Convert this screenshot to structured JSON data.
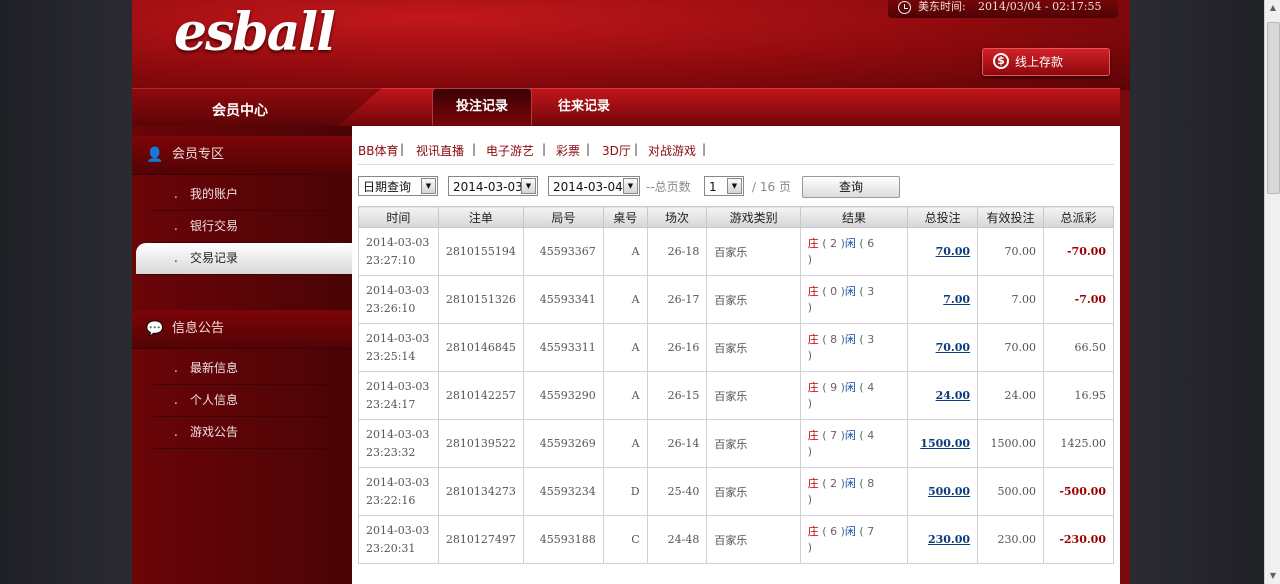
{
  "header": {
    "logo_text": "esball",
    "clock_label": "美东时间:",
    "clock_time": "2014/03/04 - 02:17:55",
    "deposit_label": "线上存款",
    "deposit_icon": "dollar-icon"
  },
  "nav": {
    "member_center": "会员中心",
    "tabs": [
      {
        "label": "投注记录",
        "active": true
      },
      {
        "label": "往来记录",
        "active": false
      }
    ]
  },
  "sidebar": {
    "section1": {
      "title": "会员专区",
      "icon": "user-icon",
      "items": [
        {
          "label": "我的账户",
          "active": false
        },
        {
          "label": "银行交易",
          "active": false
        },
        {
          "label": "交易记录",
          "active": true
        }
      ]
    },
    "section2": {
      "title": "信息公告",
      "icon": "chat-bubble-icon",
      "items": [
        {
          "label": "最新信息"
        },
        {
          "label": "个人信息"
        },
        {
          "label": "游戏公告"
        }
      ]
    },
    "bullet": "."
  },
  "categories": {
    "items": [
      "BB体育",
      "视讯直播",
      "电子游艺",
      "彩票",
      "3D厅",
      "对战游戏"
    ],
    "separator": "|"
  },
  "filter": {
    "mode": "日期查询",
    "start_date": "2014-03-03",
    "end_date": "2014-03-04",
    "total_pages_label": "--总页数",
    "current_page": "1",
    "pages_suffix": "/ 16 页",
    "query_button": "查询"
  },
  "table": {
    "columns": [
      "时间",
      "注单",
      "局号",
      "桌号",
      "场次",
      "游戏类别",
      "结果",
      "总投注",
      "有效投注",
      "总派彩"
    ],
    "banker_label": "庄",
    "player_label": "闲",
    "rows": [
      {
        "date": "2014-03-03",
        "time": "23:27:10",
        "ticket": "2810155194",
        "round": "45593367",
        "table": "A",
        "shoe": "26-18",
        "game": "百家乐",
        "banker": "2",
        "player": "6",
        "total_bet": "70.00",
        "valid_bet": "70.00",
        "payout": "-70.00"
      },
      {
        "date": "2014-03-03",
        "time": "23:26:10",
        "ticket": "2810151326",
        "round": "45593341",
        "table": "A",
        "shoe": "26-17",
        "game": "百家乐",
        "banker": "0",
        "player": "3",
        "total_bet": "7.00",
        "valid_bet": "7.00",
        "payout": "-7.00"
      },
      {
        "date": "2014-03-03",
        "time": "23:25:14",
        "ticket": "2810146845",
        "round": "45593311",
        "table": "A",
        "shoe": "26-16",
        "game": "百家乐",
        "banker": "8",
        "player": "3",
        "total_bet": "70.00",
        "valid_bet": "70.00",
        "payout": "66.50"
      },
      {
        "date": "2014-03-03",
        "time": "23:24:17",
        "ticket": "2810142257",
        "round": "45593290",
        "table": "A",
        "shoe": "26-15",
        "game": "百家乐",
        "banker": "9",
        "player": "4",
        "total_bet": "24.00",
        "valid_bet": "24.00",
        "payout": "16.95"
      },
      {
        "date": "2014-03-03",
        "time": "23:23:32",
        "ticket": "2810139522",
        "round": "45593269",
        "table": "A",
        "shoe": "26-14",
        "game": "百家乐",
        "banker": "7",
        "player": "4",
        "total_bet": "1500.00",
        "valid_bet": "1500.00",
        "payout": "1425.00"
      },
      {
        "date": "2014-03-03",
        "time": "23:22:16",
        "ticket": "2810134273",
        "round": "45593234",
        "table": "D",
        "shoe": "25-40",
        "game": "百家乐",
        "banker": "2",
        "player": "8",
        "total_bet": "500.00",
        "valid_bet": "500.00",
        "payout": "-500.00"
      },
      {
        "date": "2014-03-03",
        "time": "23:20:31",
        "ticket": "2810127497",
        "round": "45593188",
        "table": "C",
        "shoe": "24-48",
        "game": "百家乐",
        "banker": "6",
        "player": "7",
        "total_bet": "230.00",
        "valid_bet": "230.00",
        "payout": "-230.00"
      }
    ]
  }
}
